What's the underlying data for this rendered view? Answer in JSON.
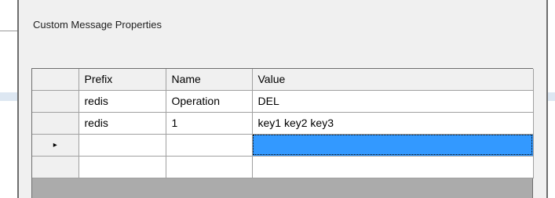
{
  "group": {
    "title": "Custom Message Properties"
  },
  "grid": {
    "columns": [
      "Prefix",
      "Name",
      "Value"
    ],
    "rows": [
      {
        "prefix": "redis",
        "name": "Operation",
        "value": "DEL"
      },
      {
        "prefix": "redis",
        "name": "1",
        "value": "key1 key2 key3"
      },
      {
        "prefix": "",
        "name": "",
        "value": ""
      },
      {
        "prefix": "",
        "name": "",
        "value": ""
      }
    ],
    "current_row_indicator": "▸",
    "selected_cell_color": "#3399ff"
  }
}
